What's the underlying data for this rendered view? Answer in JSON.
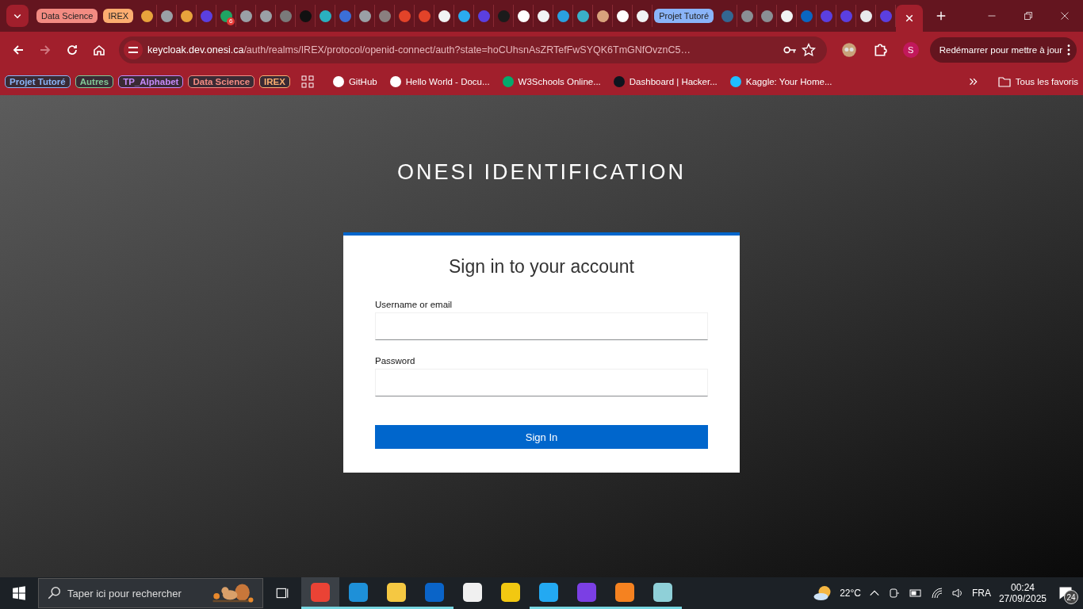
{
  "tab_strip": {
    "tabs": [
      {
        "kind": "group",
        "label": "Data Science",
        "color": "#f28b82"
      },
      {
        "kind": "group",
        "label": "IREX",
        "color": "#fcad70"
      },
      {
        "kind": "page",
        "color": "#e8a33c",
        "selected": false
      },
      {
        "kind": "page",
        "color": "#9aa0a6",
        "selected": false
      },
      {
        "kind": "page",
        "color": "#e8a33c",
        "selected": false
      },
      {
        "kind": "page",
        "color": "#5b3fe0",
        "selected": false
      },
      {
        "kind": "page",
        "color": "#1fa463",
        "selected": false,
        "badge": "6"
      },
      {
        "kind": "page",
        "color": "#9aa0a6",
        "selected": false
      },
      {
        "kind": "page",
        "color": "#9aa0a6",
        "selected": false
      },
      {
        "kind": "page",
        "color": "#7a7a7a",
        "selected": false
      },
      {
        "kind": "page",
        "color": "#111111",
        "selected": false
      },
      {
        "kind": "page",
        "color": "#2ab0c0",
        "selected": false
      },
      {
        "kind": "page",
        "color": "#3b6fd8",
        "selected": false
      },
      {
        "kind": "page",
        "color": "#9aa0a6",
        "selected": false
      },
      {
        "kind": "page",
        "color": "#8a7f7f",
        "selected": false
      },
      {
        "kind": "page",
        "color": "#e24329",
        "selected": false
      },
      {
        "kind": "page",
        "color": "#e24329",
        "selected": false
      },
      {
        "kind": "page",
        "color": "#f1f3f4",
        "selected": false
      },
      {
        "kind": "page",
        "color": "#2aabee",
        "selected": false
      },
      {
        "kind": "page",
        "color": "#5b3fe0",
        "selected": false
      },
      {
        "kind": "page",
        "color": "#1b1b1b",
        "selected": false
      },
      {
        "kind": "page",
        "color": "#ffffff",
        "selected": false
      },
      {
        "kind": "page",
        "color": "#f1f3f4",
        "selected": false
      },
      {
        "kind": "page",
        "color": "#2aa0e0",
        "selected": false
      },
      {
        "kind": "page",
        "color": "#3ab0c8",
        "selected": false
      },
      {
        "kind": "page",
        "color": "#d8a27c",
        "selected": false
      },
      {
        "kind": "page",
        "color": "#ffffff",
        "selected": false
      },
      {
        "kind": "page",
        "color": "#f1f3f4",
        "selected": false
      },
      {
        "kind": "group",
        "label": "Projet Tutoré",
        "color": "#8ab4f8"
      },
      {
        "kind": "page",
        "color": "#336791",
        "selected": false
      },
      {
        "kind": "page",
        "color": "#8a8f94",
        "selected": false
      },
      {
        "kind": "page",
        "color": "#8a8f94",
        "selected": false
      },
      {
        "kind": "page",
        "color": "#f1f3f4",
        "selected": false
      },
      {
        "kind": "page",
        "color": "#0a66c2",
        "selected": false
      },
      {
        "kind": "page",
        "color": "#5b3fe0",
        "selected": false
      },
      {
        "kind": "page",
        "color": "#5b3fe0",
        "selected": false
      },
      {
        "kind": "page",
        "color": "#e8eaed",
        "selected": false
      },
      {
        "kind": "page",
        "color": "#5b3fe0",
        "selected": false
      },
      {
        "kind": "page",
        "selected": true
      }
    ]
  },
  "toolbar": {
    "url_host": "keycloak.dev.onesi.ca",
    "url_path": "/auth/realms/IREX/protocol/openid-connect/auth?state=hoCUhsnAsZRTefFwSYQK6TmGNfOvznC5…",
    "profile": "S",
    "update_button": "Redémarrer pour mettre à jour"
  },
  "bookmarks": {
    "groups": [
      {
        "label": "Projet Tutoré",
        "color": "#8ab4f8"
      },
      {
        "label": "Autres",
        "color": "#81c995"
      },
      {
        "label": "TP_Alphabet",
        "color": "#c58af9"
      },
      {
        "label": "Data Science",
        "color": "#f28b82"
      },
      {
        "label": "IREX",
        "color": "#fcad70"
      }
    ],
    "links": [
      {
        "label": "GitHub",
        "color": "#ffffff"
      },
      {
        "label": "Hello World - Docu...",
        "color": "#ffffff"
      },
      {
        "label": "W3Schools Online...",
        "color": "#04aa6d"
      },
      {
        "label": "Dashboard | Hacker...",
        "color": "#0e141e"
      },
      {
        "label": "Kaggle: Your Home...",
        "color": "#20beff"
      }
    ],
    "all_bookmarks": "Tous les favoris"
  },
  "page": {
    "heading": "ONESI IDENTIFICATION",
    "card_title": "Sign in to your account",
    "fields": [
      {
        "label": "Username or email"
      },
      {
        "label": "Password"
      }
    ],
    "submit": "Sign In"
  },
  "taskbar": {
    "search_placeholder": "Taper ici pour rechercher",
    "apps": [
      {
        "color": "#ea4335",
        "running": true,
        "selected": true
      },
      {
        "color": "#1e90d8",
        "running": true,
        "selected": false
      },
      {
        "color": "#f5c842",
        "running": true,
        "selected": false
      },
      {
        "color": "#0a64c8",
        "running": true,
        "selected": false
      },
      {
        "color": "#f0f0f0",
        "running": false,
        "selected": false
      },
      {
        "color": "#f2c811",
        "running": false,
        "selected": false
      },
      {
        "color": "#23a9f2",
        "running": true,
        "selected": false
      },
      {
        "color": "#7b3fe4",
        "running": true,
        "selected": false
      },
      {
        "color": "#f58220",
        "running": true,
        "selected": false
      },
      {
        "color": "#8fd0d8",
        "running": true,
        "selected": false
      }
    ],
    "temperature": "22°C",
    "language": "FRA",
    "time": "00:24",
    "date": "27/09/2025",
    "notifications": "24"
  }
}
